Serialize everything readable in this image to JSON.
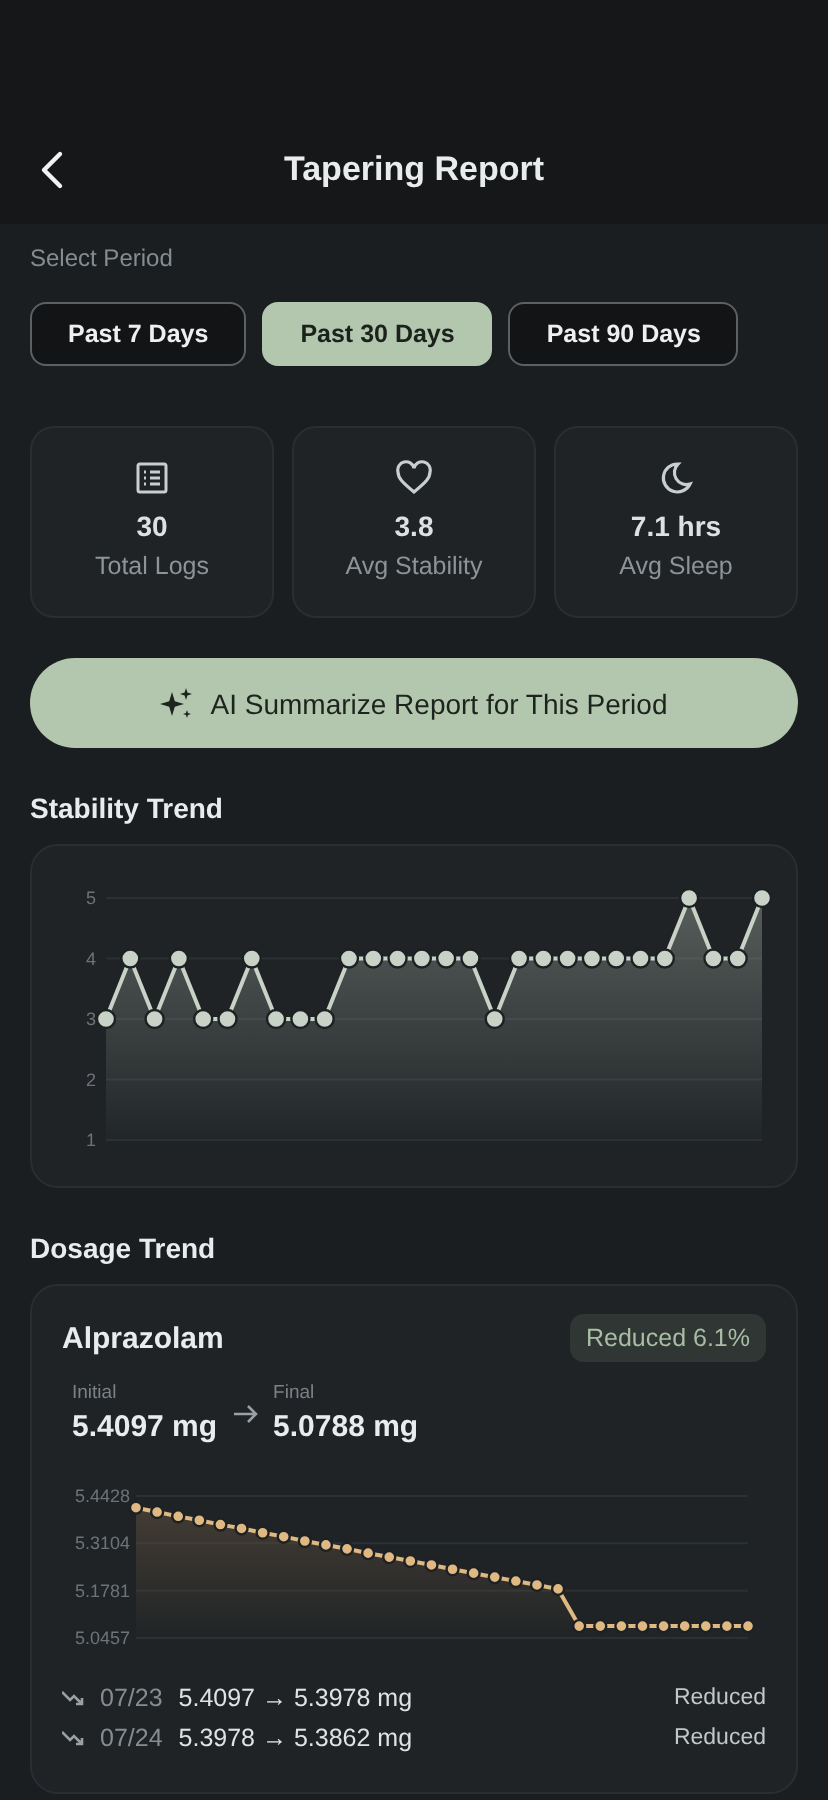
{
  "header": {
    "title": "Tapering Report"
  },
  "period": {
    "label": "Select Period",
    "tabs": [
      {
        "label": "Past 7 Days",
        "selected": false
      },
      {
        "label": "Past 30 Days",
        "selected": true
      },
      {
        "label": "Past 90 Days",
        "selected": false
      }
    ]
  },
  "stats": [
    {
      "value": "30",
      "label": "Total Logs"
    },
    {
      "value": "3.8",
      "label": "Avg Stability"
    },
    {
      "value": "7.1 hrs",
      "label": "Avg Sleep"
    }
  ],
  "ai_button": {
    "label": "AI Summarize Report for This Period"
  },
  "stability": {
    "title": "Stability Trend",
    "chart_data": {
      "type": "area",
      "grid": true,
      "categories": [
        null,
        null,
        null,
        null,
        null,
        null,
        null,
        null,
        null,
        null,
        null,
        null,
        null,
        null,
        null,
        null,
        null,
        null,
        null,
        null,
        null,
        null,
        null,
        null,
        null,
        null,
        null,
        null
      ],
      "series": [
        {
          "color": "#c8d2c6",
          "marker": true,
          "values": [
            3,
            4,
            3,
            4,
            3,
            3,
            4,
            3,
            3,
            3,
            4,
            4,
            4,
            4,
            4,
            4,
            3,
            4,
            4,
            4,
            4,
            4,
            4,
            4,
            5,
            4,
            4,
            5
          ]
        }
      ],
      "ylim": [
        1,
        5
      ],
      "yticks": [
        1,
        2,
        3,
        4,
        5
      ]
    }
  },
  "dosage": {
    "title": "Dosage Trend",
    "medications": [
      {
        "name": "Alprazolam",
        "badge": "Reduced 6.1%",
        "initial_label": "Initial",
        "initial": "5.4097 mg",
        "final_label": "Final",
        "final": "5.0788 mg",
        "chart_data": {
          "type": "area",
          "grid": true,
          "categories": [
            null,
            null,
            null,
            null,
            null,
            null,
            null,
            null,
            null,
            null,
            null,
            null,
            null,
            null,
            null,
            null,
            null,
            null,
            null,
            null,
            null,
            null,
            null,
            null,
            null,
            null,
            null,
            null,
            null,
            null
          ],
          "series": [
            {
              "color": "#e0b982",
              "marker": true,
              "values": [
                5.41,
                5.398,
                5.386,
                5.375,
                5.363,
                5.352,
                5.34,
                5.329,
                5.317,
                5.306,
                5.295,
                5.283,
                5.272,
                5.261,
                5.25,
                5.238,
                5.227,
                5.216,
                5.205,
                5.194,
                5.183,
                5.079,
                5.079,
                5.079,
                5.079,
                5.079,
                5.079,
                5.079,
                5.079,
                5.079
              ]
            }
          ],
          "ylim": [
            5.0457,
            5.4428
          ],
          "yticks": [
            5.0457,
            5.1781,
            5.3104,
            5.4428
          ]
        },
        "changes": [
          {
            "date": "07/23",
            "change": "5.4097 → 5.3978 mg",
            "status": "Reduced"
          },
          {
            "date": "07/24",
            "change": "5.3978 → 5.3862 mg",
            "status": "Reduced"
          }
        ]
      }
    ]
  }
}
